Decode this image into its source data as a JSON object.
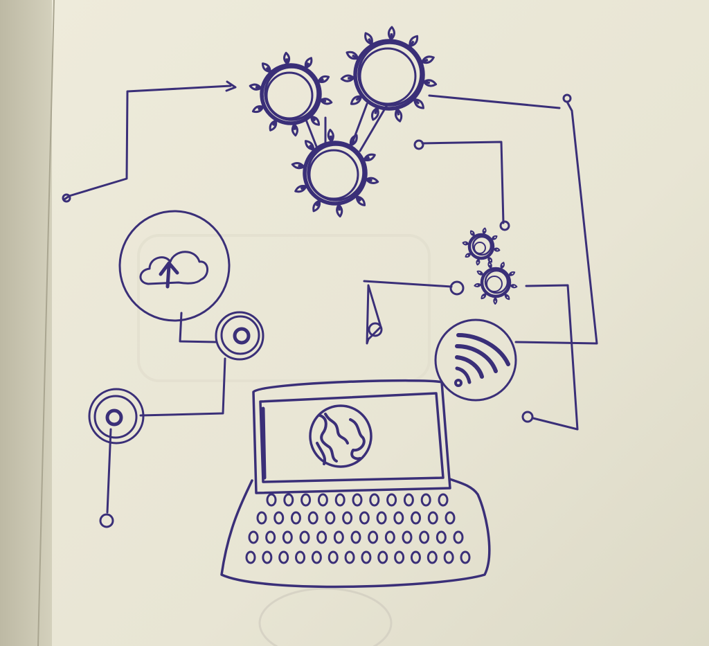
{
  "colors": {
    "paper": "#ebe8d8",
    "paper_shadow": "#d3d0bd",
    "page_edge": "#c9c5b1",
    "ink": "#3a2f78",
    "ink_dark": "#2a2160"
  },
  "icons": {
    "gear_cluster_large": "gear-icon",
    "gear_cluster_small": "gear-icon",
    "cloud": "cloud-upload-icon",
    "nodes": "node-icon",
    "wifi": "wifi-icon",
    "laptop": "laptop-icon",
    "globe": "globe-icon",
    "signal_bars": "signal-icon"
  }
}
